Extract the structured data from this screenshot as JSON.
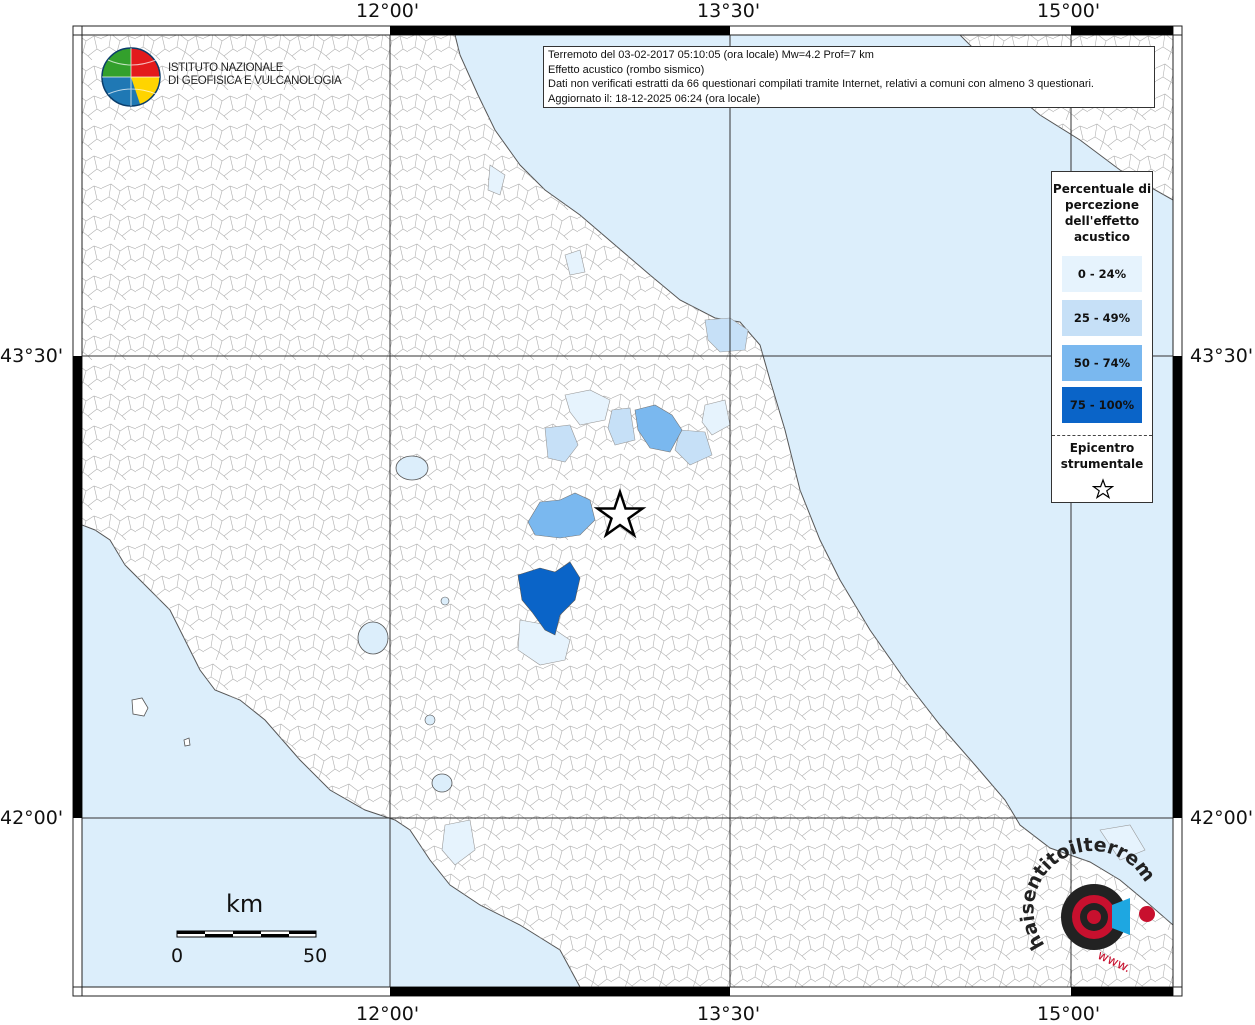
{
  "map": {
    "lon_labels": [
      "12°00'",
      "13°30'",
      "15°00'"
    ],
    "lat_labels": [
      "43°30'",
      "42°00'"
    ]
  },
  "header": {
    "logo_line1": "ISTITUTO NAZIONALE",
    "logo_line2": "DI GEOFISICA E VULCANOLOGIA"
  },
  "info": {
    "line1": "Terremoto del 03-02-2017 05:10:05 (ora locale) Mw=4.2 Prof=7 km",
    "line2": "Effetto acustico (rombo sismico)",
    "line3": "Dati non verificati estratti da 66 questionari compilati tramite Internet, relativi a comuni con almeno 3 questionari.",
    "line4": "Aggiornato il: 18-12-2025 06:24 (ora locale)"
  },
  "legend": {
    "title": "Percentuale di percezione dell'effetto acustico",
    "classes": [
      {
        "label": "0 - 24%",
        "color": "#e6f3fd"
      },
      {
        "label": "25 - 49%",
        "color": "#c6e0f7"
      },
      {
        "label": "50 - 74%",
        "color": "#7ab8ef"
      },
      {
        "label": "75 - 100%",
        "color": "#0a64c8"
      }
    ],
    "epicenter_label": "Epicentro strumentale",
    "epicenter_symbol": "star-icon"
  },
  "scale": {
    "title": "km",
    "min_label": "0",
    "max_label": "50"
  },
  "watermark": {
    "text_main": "haisentitoilterremoto.it",
    "text_sub": "www."
  },
  "colors": {
    "sea": "#dceefb",
    "land": "#ffffff",
    "boundary": "#9a9a9a",
    "grid": "#333333"
  }
}
